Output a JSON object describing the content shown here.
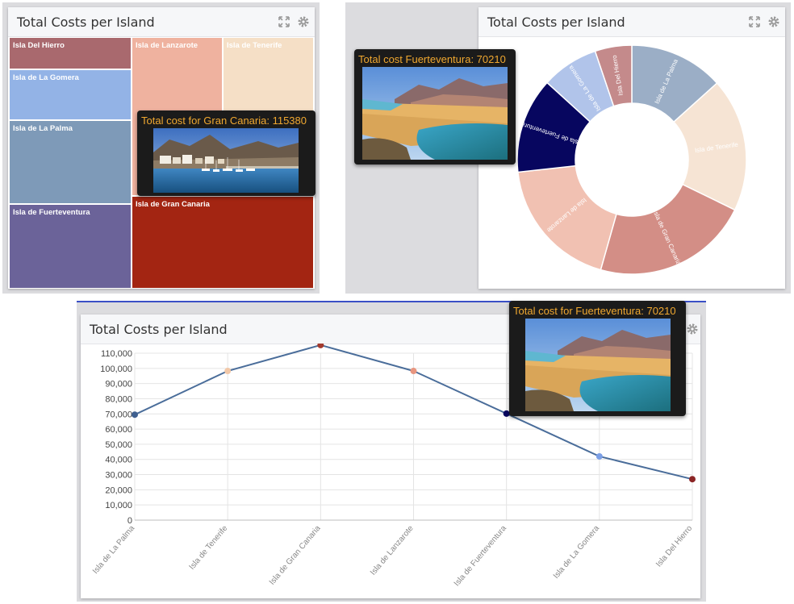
{
  "widgets": {
    "treemap_title": "Total Costs per Island",
    "donut_title": "Total Costs per Island",
    "line_title": "Total Costs per Island"
  },
  "header_icons": [
    "expand-icon",
    "gear-icon"
  ],
  "tooltips": {
    "treemap": "Total cost for Gran Canaria: 115380",
    "donut": "Total cost Fuerteventura: 70210",
    "line": "Total cost for Fuerteventura: 70210"
  },
  "chart_data": [
    {
      "type": "treemap",
      "title": "Total Costs per Island",
      "items": [
        {
          "name": "Isla Del Hierro",
          "value": 27000,
          "color": "#a9696e"
        },
        {
          "name": "Isla de La Gomera",
          "value": 42000,
          "color": "#93b3e6"
        },
        {
          "name": "Isla de La Palma",
          "value": 69500,
          "color": "#7e9ab8"
        },
        {
          "name": "Isla de Fuerteventura",
          "value": 70210,
          "color": "#6b6399"
        },
        {
          "name": "Isla de Lanzarote",
          "value": 98300,
          "color": "#efb29f"
        },
        {
          "name": "Isla de Tenerife",
          "value": 98300,
          "color": "#f5dfc6"
        },
        {
          "name": "Isla de Gran Canaria",
          "value": 115380,
          "color": "#a32512"
        }
      ]
    },
    {
      "type": "pie",
      "variant": "donut",
      "title": "Total Costs per Island",
      "slices": [
        {
          "name": "Isla de La Palma",
          "value": 69500,
          "color": "#9baec6"
        },
        {
          "name": "Isla de Tenerife",
          "value": 98300,
          "color": "#f6e4d4"
        },
        {
          "name": "Isla de Gran Canaria",
          "value": 115380,
          "color": "#d38e86"
        },
        {
          "name": "Isla de Lanzarote",
          "value": 98300,
          "color": "#f1c1b2"
        },
        {
          "name": "Isla de Fuerteventura",
          "value": 70210,
          "color": "#07065f"
        },
        {
          "name": "Isla de La Gomera",
          "value": 42000,
          "color": "#b1c4ea"
        },
        {
          "name": "Isla Del Hierro",
          "value": 27000,
          "color": "#c48a8b"
        }
      ]
    },
    {
      "type": "line",
      "title": "Total Costs per Island",
      "categories": [
        "Isla de La Palma",
        "Isla de Tenerife",
        "Isla de Gran Canaria",
        "Isla de Lanzarote",
        "Isla de Fuerteventura",
        "Isla de La Gomera",
        "Isla Del Hierro"
      ],
      "values": [
        69500,
        98300,
        115380,
        98300,
        70210,
        42000,
        27000
      ],
      "point_colors": [
        "#3f5f8f",
        "#f2c8a8",
        "#a23a2e",
        "#e89680",
        "#07065f",
        "#7b9fe6",
        "#8b2525"
      ],
      "line_color": "#4a6d9a",
      "ylim": [
        0,
        110000
      ],
      "yticks": [
        0,
        10000,
        20000,
        30000,
        40000,
        50000,
        60000,
        70000,
        80000,
        90000,
        100000,
        110000
      ],
      "ytick_labels": [
        "0",
        "10,000",
        "20,000",
        "30,000",
        "40,000",
        "50,000",
        "60,000",
        "70,000",
        "80,000",
        "90,000",
        "100,000",
        "110,000"
      ],
      "grid": true
    }
  ]
}
